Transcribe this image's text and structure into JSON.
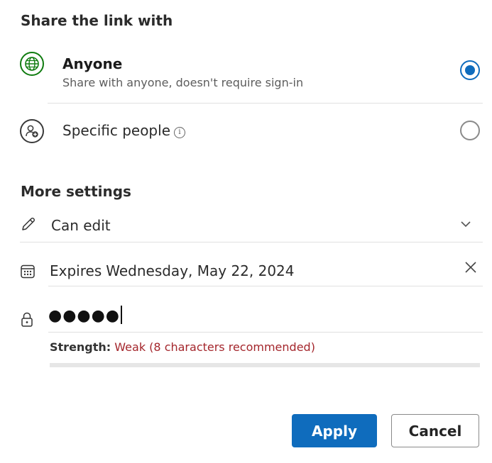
{
  "share_section": {
    "heading": "Share the link with",
    "options": [
      {
        "title": "Anyone",
        "subtitle": "Share with anyone, doesn't require sign-in",
        "icon": "globe-icon",
        "selected": true
      },
      {
        "title": "Specific people",
        "subtitle": "",
        "icon": "person-add-icon",
        "info_icon": "info-icon",
        "selected": false
      }
    ]
  },
  "more_settings": {
    "heading": "More settings",
    "permission": {
      "icon": "pencil-icon",
      "value": "Can edit",
      "dropdown_icon": "chevron-down-icon"
    },
    "expiry": {
      "icon": "calendar-icon",
      "label": "Expires",
      "value": "Wednesday, May 22, 2024",
      "clear_icon": "close-icon"
    },
    "password": {
      "icon": "lock-icon",
      "masked_value": "●●●●●",
      "strength_label": "Strength:",
      "strength_value": "Weak (8 characters recommended)"
    }
  },
  "buttons": {
    "apply_label": "Apply",
    "cancel_label": "Cancel"
  },
  "colors": {
    "accent": "#0f6cbd",
    "globe": "#107c10",
    "strength_weak": "#a4262c"
  }
}
